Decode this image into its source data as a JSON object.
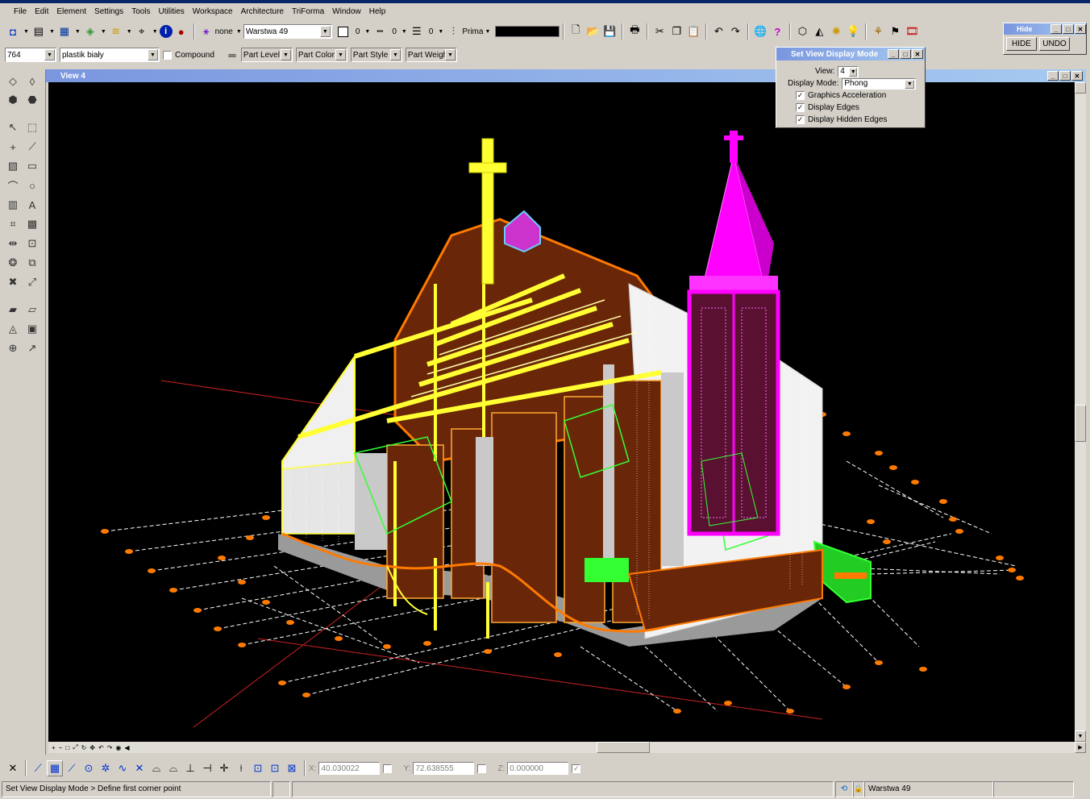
{
  "menu": [
    "File",
    "Edit",
    "Element",
    "Settings",
    "Tools",
    "Utilities",
    "Workspace",
    "Architecture",
    "TriForma",
    "Window",
    "Help"
  ],
  "toolbar1": {
    "class_value": "none",
    "level_value": "Warstwa 49",
    "color_value": "0",
    "style_value": "0",
    "weight_value": "0",
    "priority_label": "Prima"
  },
  "toolbar2": {
    "part_number": "764",
    "material": "plastik biały",
    "compound_label": "Compound",
    "part_level": "Part Level",
    "part_color": "Part Color",
    "part_style": "Part Style",
    "part_weight": "Part Weigh"
  },
  "hide_panel": {
    "title": "Hide",
    "hide_label": "HIDE",
    "undo_label": "UNDO"
  },
  "dialog": {
    "title": "Set View Display Mode",
    "view_label": "View:",
    "view_value": "4",
    "mode_label": "Display Mode:",
    "mode_value": "Phong",
    "opt1": "Graphics Acceleration",
    "opt2": "Display Edges",
    "opt3": "Display Hidden Edges"
  },
  "view_window": {
    "title": "View 4"
  },
  "coords": {
    "x_label": "X:",
    "x_value": "40.030022",
    "y_label": "Y:",
    "y_value": "72.638555",
    "z_label": "Z:",
    "z_value": "0.000000"
  },
  "status": {
    "prompt": "Set View Display Mode > Define first corner point",
    "active_level": "Warstwa 49"
  },
  "colors": {
    "tower": "#ff00ff",
    "structure": "#ffff33",
    "wall": "#7a2a0a",
    "accent_orange": "#ff7a00",
    "green": "#33ff33"
  }
}
